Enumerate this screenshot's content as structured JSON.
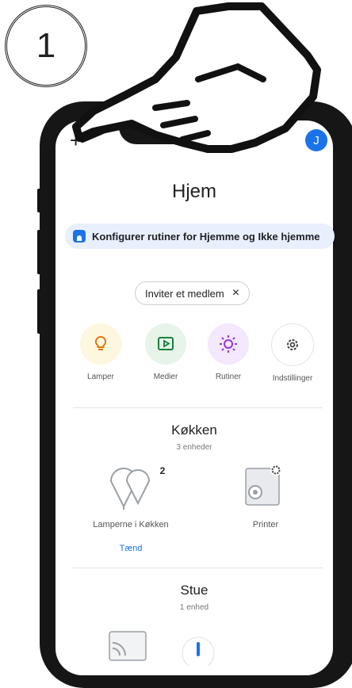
{
  "step_number": "1",
  "header": {
    "add_icon": "plus-icon",
    "avatar_initial": "J"
  },
  "home": {
    "title": "Hjem"
  },
  "banner": {
    "icon": "home-icon",
    "text": "Konfigurer rutiner for Hjemme og Ikke hjemme"
  },
  "invite_chip": {
    "label": "Inviter et medlem",
    "close": "×"
  },
  "shortcuts": [
    {
      "label": "Lamper",
      "icon": "lightbulb-icon",
      "color": "#fef7e0",
      "icon_color": "#e37400"
    },
    {
      "label": "Medier",
      "icon": "play-icon",
      "color": "#e6f4ea",
      "icon_color": "#188038"
    },
    {
      "label": "Rutiner",
      "icon": "routine-sun-icon",
      "color": "#f3e8fd",
      "icon_color": "#9334e6"
    },
    {
      "label": "Indstillinger",
      "icon": "gear-icon",
      "color": "#ffffff",
      "icon_color": "#444444"
    }
  ],
  "rooms": [
    {
      "name": "Køkken",
      "count": "3 enheder",
      "devices": [
        {
          "label": "Lamperne i Køkken",
          "badge": "2",
          "action": "Tænd",
          "icon": "lamp-group-icon"
        },
        {
          "label": "Printer",
          "icon": "speaker-device-icon"
        }
      ]
    },
    {
      "name": "Stue",
      "count": "1 enhed",
      "devices": []
    }
  ],
  "colors": {
    "accent": "#1a73e8",
    "banner_bg": "#e8f0fe"
  }
}
